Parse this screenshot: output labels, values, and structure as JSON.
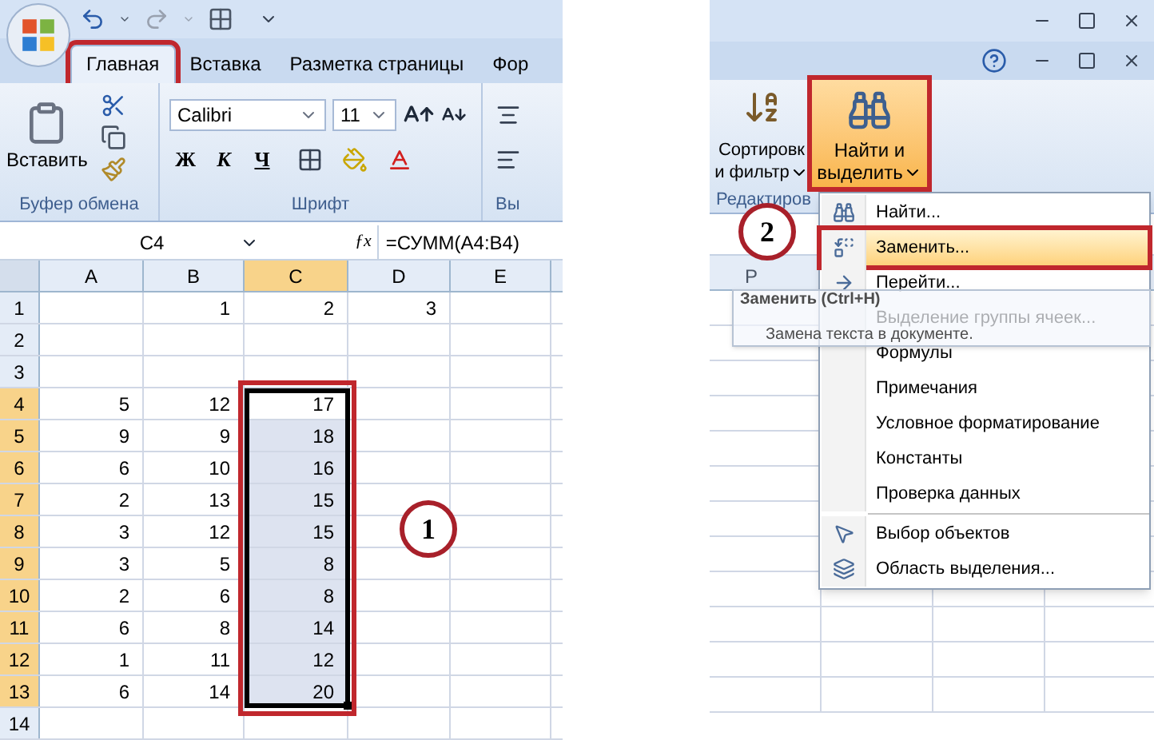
{
  "left": {
    "tabs": [
      {
        "label": "Главная",
        "selected": true,
        "marked": true
      },
      {
        "label": "Вставка",
        "selected": false,
        "marked": false
      },
      {
        "label": "Разметка страницы",
        "selected": false,
        "marked": false
      },
      {
        "label": "Фор",
        "selected": false,
        "marked": false
      }
    ],
    "ribbon": {
      "clipboard": {
        "paste_label": "Вставить",
        "group_label": "Буфер обмена"
      },
      "font": {
        "font_name": "Calibri",
        "font_size": "11",
        "bold": "Ж",
        "italic": "К",
        "underline": "Ч",
        "group_label": "Шрифт"
      },
      "alignment": {
        "group_label": "Вы"
      }
    },
    "formula_bar": {
      "name_box": "C4",
      "function_label": "ƒx",
      "formula": "=СУММ(A4:B4)"
    },
    "sheet": {
      "columns": [
        {
          "label": "A",
          "selected": false
        },
        {
          "label": "B",
          "selected": false
        },
        {
          "label": "C",
          "selected": true
        },
        {
          "label": "D",
          "selected": false
        },
        {
          "label": "E",
          "selected": false
        }
      ],
      "rows": [
        {
          "label": "1",
          "selected": false,
          "shaded": false,
          "cells": {
            "b": "1",
            "c": "2",
            "d": "3"
          }
        },
        {
          "label": "2",
          "selected": false,
          "shaded": false,
          "cells": {}
        },
        {
          "label": "3",
          "selected": false,
          "shaded": false,
          "cells": {}
        },
        {
          "label": "4",
          "selected": true,
          "shaded": false,
          "cells": {
            "a": "5",
            "b": "12",
            "c": "17"
          }
        },
        {
          "label": "5",
          "selected": true,
          "shaded": true,
          "cells": {
            "a": "9",
            "b": "9",
            "c": "18"
          }
        },
        {
          "label": "6",
          "selected": true,
          "shaded": true,
          "cells": {
            "a": "6",
            "b": "10",
            "c": "16"
          }
        },
        {
          "label": "7",
          "selected": true,
          "shaded": true,
          "cells": {
            "a": "2",
            "b": "13",
            "c": "15"
          }
        },
        {
          "label": "8",
          "selected": true,
          "shaded": true,
          "cells": {
            "a": "3",
            "b": "12",
            "c": "15"
          }
        },
        {
          "label": "9",
          "selected": true,
          "shaded": true,
          "cells": {
            "a": "3",
            "b": "5",
            "c": "8"
          }
        },
        {
          "label": "10",
          "selected": true,
          "shaded": true,
          "cells": {
            "a": "2",
            "b": "6",
            "c": "8"
          }
        },
        {
          "label": "11",
          "selected": true,
          "shaded": true,
          "cells": {
            "a": "6",
            "b": "8",
            "c": "14"
          }
        },
        {
          "label": "12",
          "selected": true,
          "shaded": true,
          "cells": {
            "a": "1",
            "b": "11",
            "c": "12"
          }
        },
        {
          "label": "13",
          "selected": true,
          "shaded": true,
          "cells": {
            "a": "6",
            "b": "14",
            "c": "20"
          }
        },
        {
          "label": "14",
          "selected": false,
          "shaded": false,
          "cells": {}
        }
      ],
      "callout": "1"
    }
  },
  "right": {
    "ribbon": {
      "sort_button": {
        "line1": "Сортировк",
        "line2": "и фильтр"
      },
      "find_button": {
        "line1": "Найти и",
        "line2": "выделить",
        "marked": true
      },
      "group_label": "Редактиров"
    },
    "sheet": {
      "column_label": "P"
    },
    "callout": "2",
    "menu": {
      "items": [
        {
          "label": "Найти...",
          "kind": "find",
          "selected": false,
          "marked": false
        },
        {
          "label": "Заменить...",
          "kind": "replace",
          "selected": true,
          "marked": true
        },
        {
          "label": "Перейти...",
          "kind": "goto",
          "selected": false,
          "marked": false
        },
        {
          "label": "Выделение группы ячеек...",
          "kind": "plain",
          "selected": false,
          "marked": false
        },
        {
          "label": "Формулы",
          "kind": "plain",
          "selected": false,
          "marked": false
        },
        {
          "label": "Примечания",
          "kind": "plain",
          "selected": false,
          "marked": false
        },
        {
          "label": "Условное форматирование",
          "kind": "plain",
          "selected": false,
          "marked": false
        },
        {
          "label": "Константы",
          "kind": "plain",
          "selected": false,
          "marked": false
        },
        {
          "label": "Проверка данных",
          "kind": "plain",
          "selected": false,
          "marked": false
        },
        {
          "label": "Выбор объектов",
          "kind": "pointer",
          "selected": false,
          "marked": false
        },
        {
          "label": "Область выделения...",
          "kind": "pane",
          "selected": false,
          "marked": false
        }
      ]
    },
    "tooltip": {
      "title": "Заменить (Ctrl+H)",
      "description": "Замена текста в документе."
    }
  }
}
